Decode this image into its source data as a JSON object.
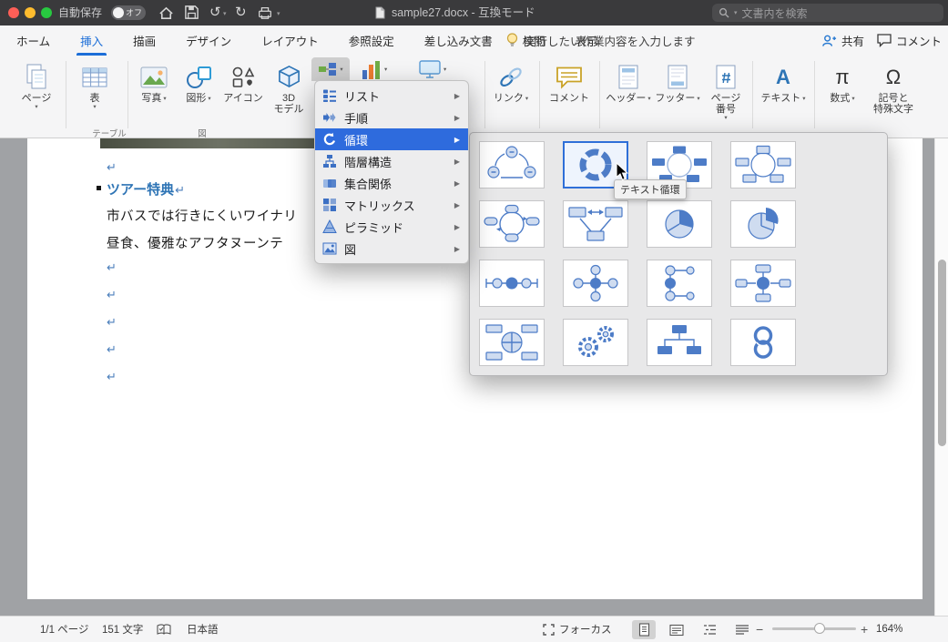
{
  "icons": {
    "chevron_down": "▾",
    "submenu_arrow": "▶",
    "pilcrow": "↵",
    "undo": "↺",
    "redo": "↻",
    "minus": "−",
    "plus": "+",
    "pi": "π",
    "omega": "Ω",
    "letter_a": "A"
  },
  "titlebar": {
    "autosave_label": "自動保存",
    "autosave_state": "オフ",
    "doc_title": "sample27.docx  -  互換モード",
    "search_placeholder": "文書内を検索"
  },
  "tabbar": {
    "tabs": [
      {
        "label": "ホーム"
      },
      {
        "label": "挿入"
      },
      {
        "label": "描画"
      },
      {
        "label": "デザイン"
      },
      {
        "label": "レイアウト"
      },
      {
        "label": "参照設定"
      },
      {
        "label": "差し込み文書"
      },
      {
        "label": "校閲"
      },
      {
        "label": "表示"
      }
    ],
    "tellme": "実行したい作業内容を入力します",
    "share": "共有",
    "comments": "コメント"
  },
  "ribbon": {
    "pages": "ページ",
    "table": "表",
    "photo": "写真",
    "shapes": "図形",
    "icons_button": "アイコン",
    "model3d": "3D\nモデル",
    "link": "リンク",
    "comment": "コメント",
    "header": "ヘッダー",
    "footer": "フッター",
    "page_number": "ページ\n番号",
    "text": "テキスト",
    "equation": "数式",
    "symbol": "記号と\n特殊文字",
    "group_table": "テーブル",
    "group_illustrations": "図"
  },
  "smartart_menu": {
    "items": [
      {
        "label": "リスト"
      },
      {
        "label": "手順"
      },
      {
        "label": "循環"
      },
      {
        "label": "階層構造"
      },
      {
        "label": "集合関係"
      },
      {
        "label": "マトリックス"
      },
      {
        "label": "ピラミッド"
      },
      {
        "label": "図"
      }
    ]
  },
  "gallery": {
    "tooltip": "テキスト循環"
  },
  "document": {
    "heading": "ツアー特典",
    "body_line1": "市バスでは行きにくいワイナリ",
    "body_line2": "昼食、優雅なアフタヌーンテ"
  },
  "statusbar": {
    "page_count": "1/1 ページ",
    "char_count": "151 文字",
    "language": "日本語",
    "focus": "フォーカス",
    "zoom_level": "164%"
  },
  "colors": {
    "accent_blue": "#2e6fd8",
    "heading_blue": "#2e74b5",
    "menu_highlight": "#2e6bdd",
    "titlebar_bg": "#3a3a3c"
  }
}
